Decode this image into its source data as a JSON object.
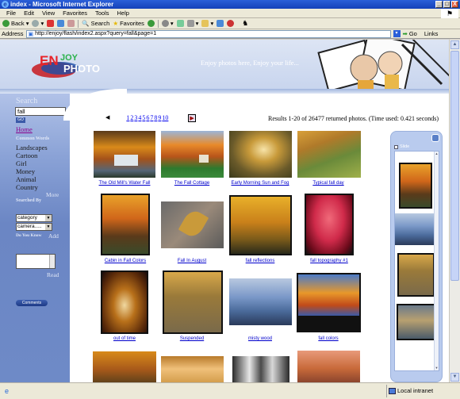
{
  "window": {
    "title": "index - Microsoft Internet Explorer",
    "minimize": "_",
    "maximize": "□",
    "close": "X"
  },
  "menu": {
    "items": [
      "File",
      "Edit",
      "View",
      "Favorites",
      "Tools",
      "Help"
    ]
  },
  "toolbar": {
    "back": "Back",
    "search": "Search",
    "favorites": "Favorites"
  },
  "address": {
    "label": "Address",
    "url": "http://enjoy/flash/index2.aspx?query=fall&page=1",
    "go": "Go",
    "links": "Links"
  },
  "banner": {
    "logo": "ENJOY PHOTO",
    "tagline": "Enjoy photos here, Enjoy your life..."
  },
  "sidebar": {
    "search_title": "Search",
    "search_value": "fall",
    "go": "GO",
    "home": "Home",
    "common_words_title": "Common Words",
    "common_words": [
      "Landscapes",
      "Cartoon",
      "Girl",
      "Money",
      "Animal",
      "Country"
    ],
    "more": "More",
    "searched_by": "Searched By",
    "category_select": "category",
    "camera_select": "camera.....",
    "do_you_know": "Do You Know",
    "add": "Add",
    "read": "Read",
    "comments": "Comments"
  },
  "pager": {
    "prev": "◀",
    "pages": [
      "1",
      "2",
      "3",
      "4",
      "5",
      "6",
      "7",
      "8",
      "9",
      "10"
    ],
    "next": "▶"
  },
  "results_text": "Results 1-20 of 26477 returned photos. (Time used: 0.421 seconds)",
  "photos": [
    {
      "caption": "The Old Mill's Water Fall"
    },
    {
      "caption": "The Fall Cottage"
    },
    {
      "caption": "Early Morning Sun and Fog"
    },
    {
      "caption": "Typical fall day"
    },
    {
      "caption": "Cabin in Fall Colors"
    },
    {
      "caption": "Fall In August"
    },
    {
      "caption": "fall reflections"
    },
    {
      "caption": "fall topography #1"
    },
    {
      "caption": "out of time"
    },
    {
      "caption": "Suspended"
    },
    {
      "caption": "misty wood"
    },
    {
      "caption": "fall colors"
    },
    {
      "caption": ""
    },
    {
      "caption": ""
    },
    {
      "caption": ""
    },
    {
      "caption": ""
    }
  ],
  "slide": {
    "label": "Slide"
  },
  "status": {
    "zone": "Local intranet"
  }
}
